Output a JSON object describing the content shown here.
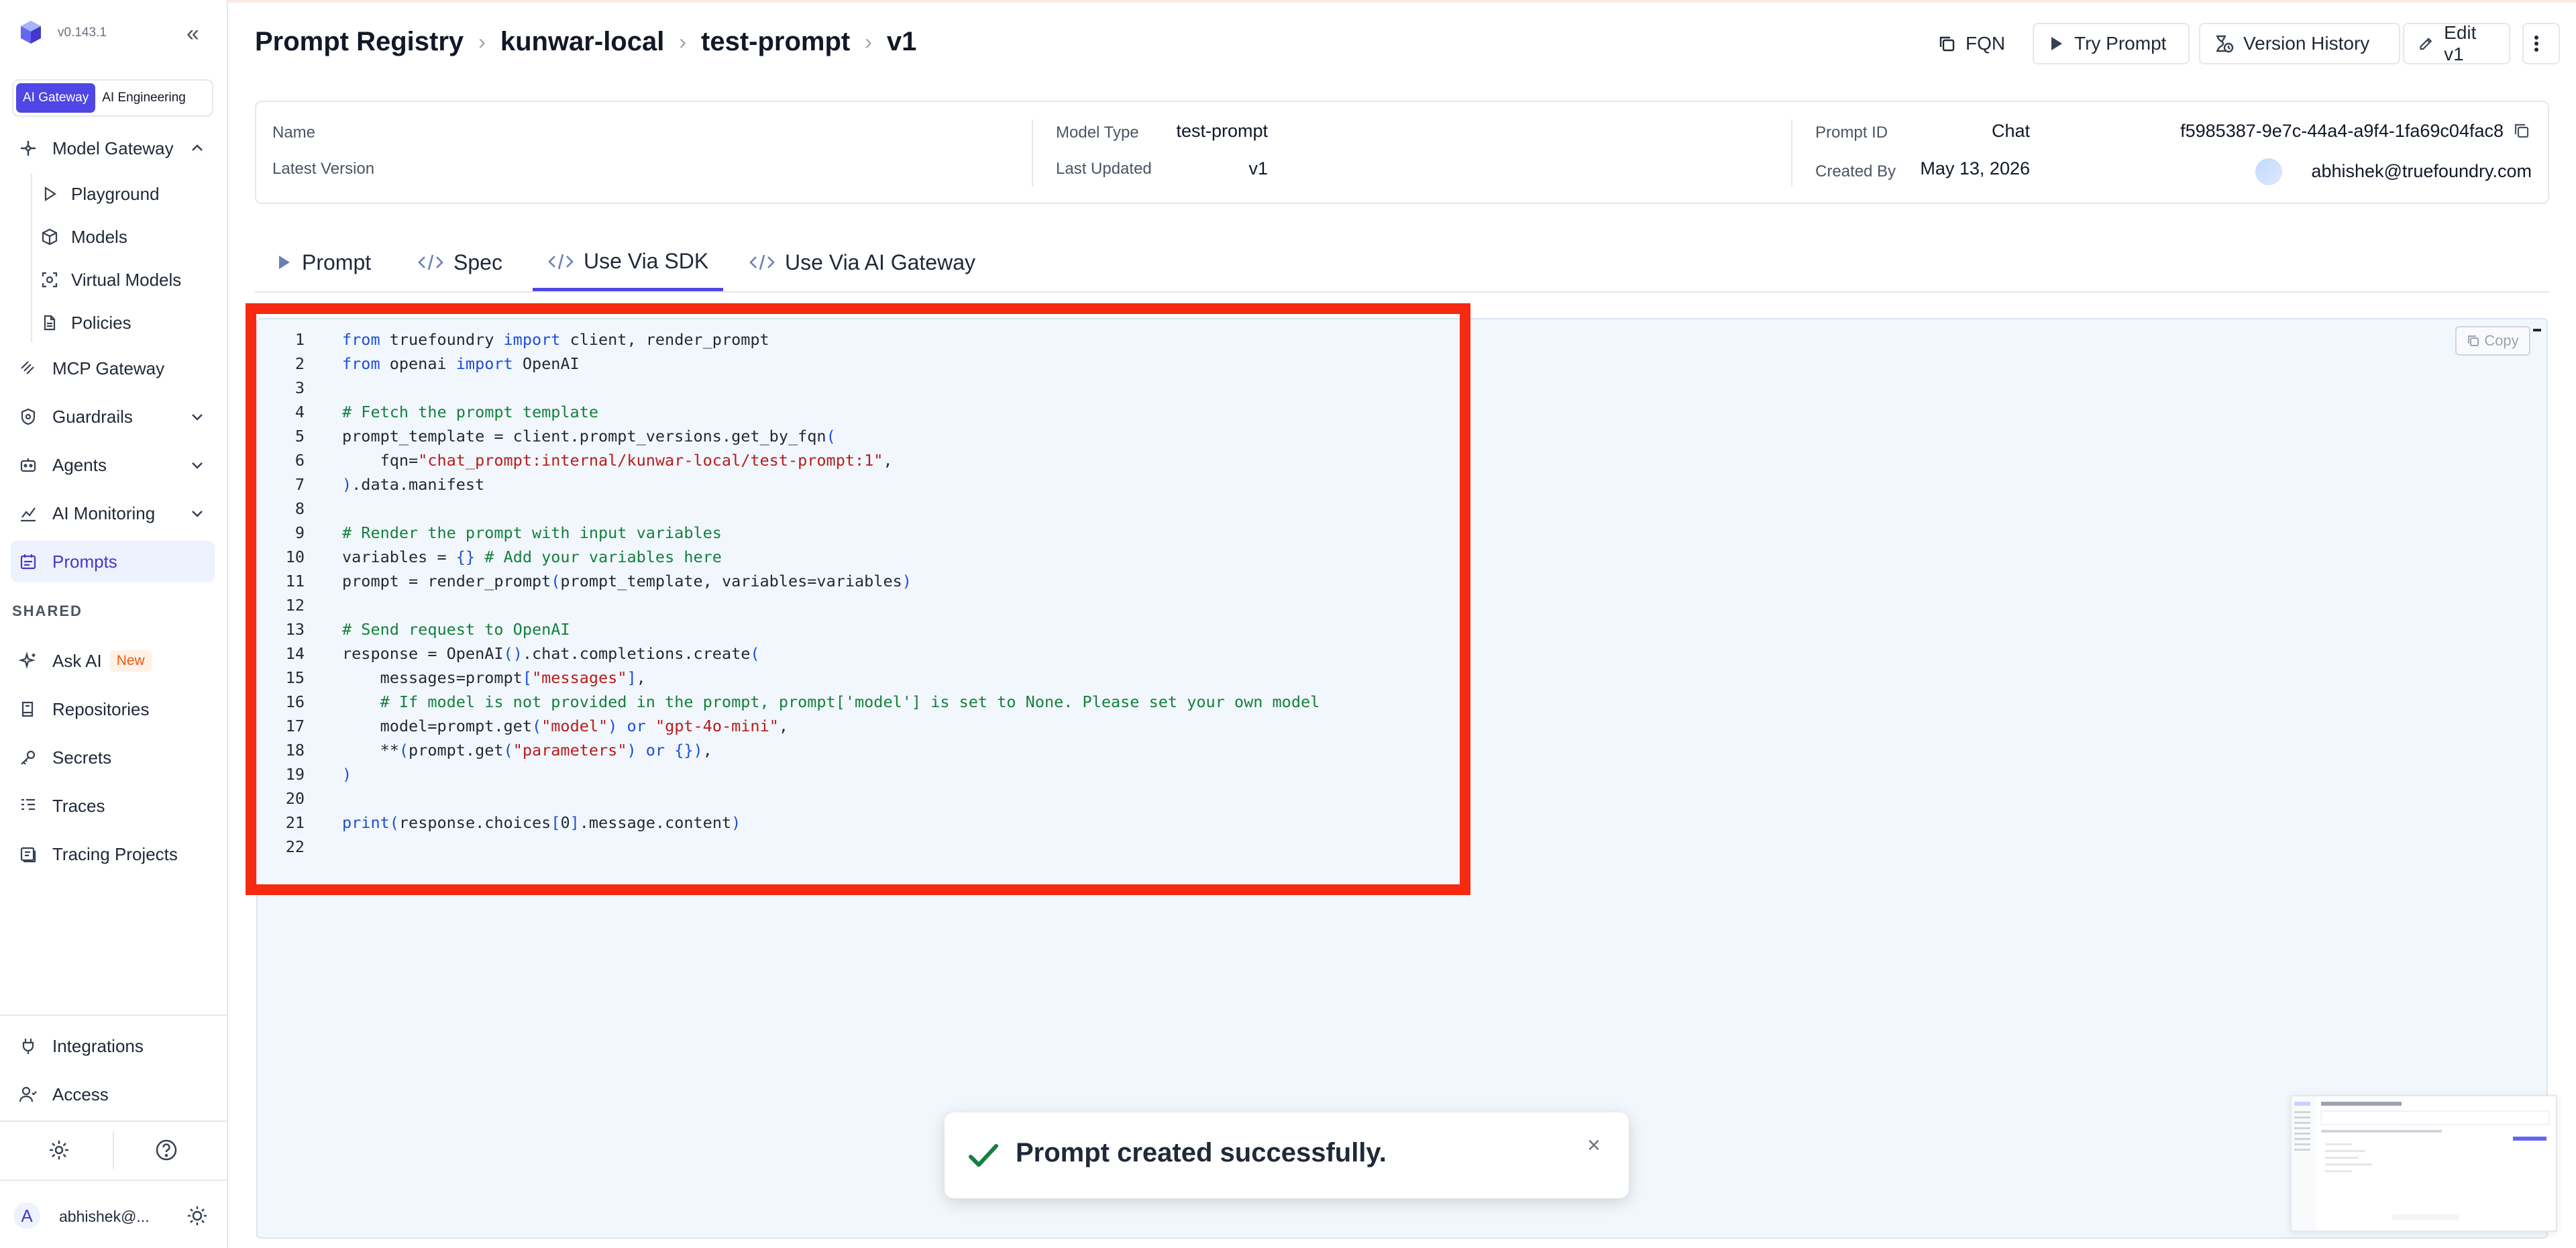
{
  "app": {
    "version": "v0.143.1"
  },
  "product_switch": {
    "options": [
      "AI Gateway",
      "AI Engineering"
    ],
    "active": "AI Gateway"
  },
  "sidebar": {
    "model_gateway": {
      "label": "Model Gateway",
      "children": [
        "Playground",
        "Models",
        "Virtual Models",
        "Policies"
      ]
    },
    "items": [
      "MCP Gateway",
      "Guardrails",
      "Agents",
      "AI Monitoring",
      "Prompts"
    ],
    "active": "Prompts",
    "shared_title": "SHARED",
    "shared_items": [
      "Ask AI",
      "Repositories",
      "Secrets",
      "Traces",
      "Tracing Projects"
    ],
    "ask_ai_badge": "New",
    "bottom_items": [
      "Integrations",
      "Access"
    ],
    "user": {
      "initial": "A",
      "name": "abhishek@..."
    }
  },
  "breadcrumb": [
    "Prompt Registry",
    "kunwar-local",
    "test-prompt",
    "v1"
  ],
  "header_actions": {
    "fqn": "FQN",
    "try": "Try Prompt",
    "history": "Version History",
    "edit": "Edit v1"
  },
  "info": {
    "name_label": "Name",
    "name": "test-prompt",
    "latest_label": "Latest Version",
    "latest": "v1",
    "model_type_label": "Model Type",
    "model_type": "Chat",
    "updated_label": "Last Updated",
    "updated": "May 13, 2026",
    "prompt_id_label": "Prompt ID",
    "prompt_id": "f5985387-9e7c-44a4-a9f4-1fa69c04fac8",
    "created_by_label": "Created By",
    "created_by": "abhishek@truefoundry.com"
  },
  "tabs": [
    "Prompt",
    "Spec",
    "Use Via SDK",
    "Use Via AI Gateway"
  ],
  "active_tab": "Use Via SDK",
  "copy_label": "Copy",
  "code_lines": [
    "from truefoundry import client, render_prompt",
    "from openai import OpenAI",
    "",
    "# Fetch the prompt template",
    "prompt_template = client.prompt_versions.get_by_fqn(",
    "    fqn=\"chat_prompt:internal/kunwar-local/test-prompt:1\",",
    ").data.manifest",
    "",
    "# Render the prompt with input variables",
    "variables = {} # Add your variables here",
    "prompt = render_prompt(prompt_template, variables=variables)",
    "",
    "# Send request to OpenAI",
    "response = OpenAI().chat.completions.create(",
    "    messages=prompt[\"messages\"],",
    "    # If model is not provided in the prompt, prompt['model'] is set to None. Please set your own model",
    "    model=prompt.get(\"model\") or \"gpt-4o-mini\",",
    "    **(prompt.get(\"parameters\") or {}),",
    ")",
    "",
    "print(response.choices[0].message.content)",
    ""
  ],
  "toast": {
    "message": "Prompt created successfully.",
    "close": "×"
  },
  "colors": {
    "accent": "#4f46e5",
    "highlight": "#f52a10",
    "code_bg": "#f1f7fc"
  }
}
